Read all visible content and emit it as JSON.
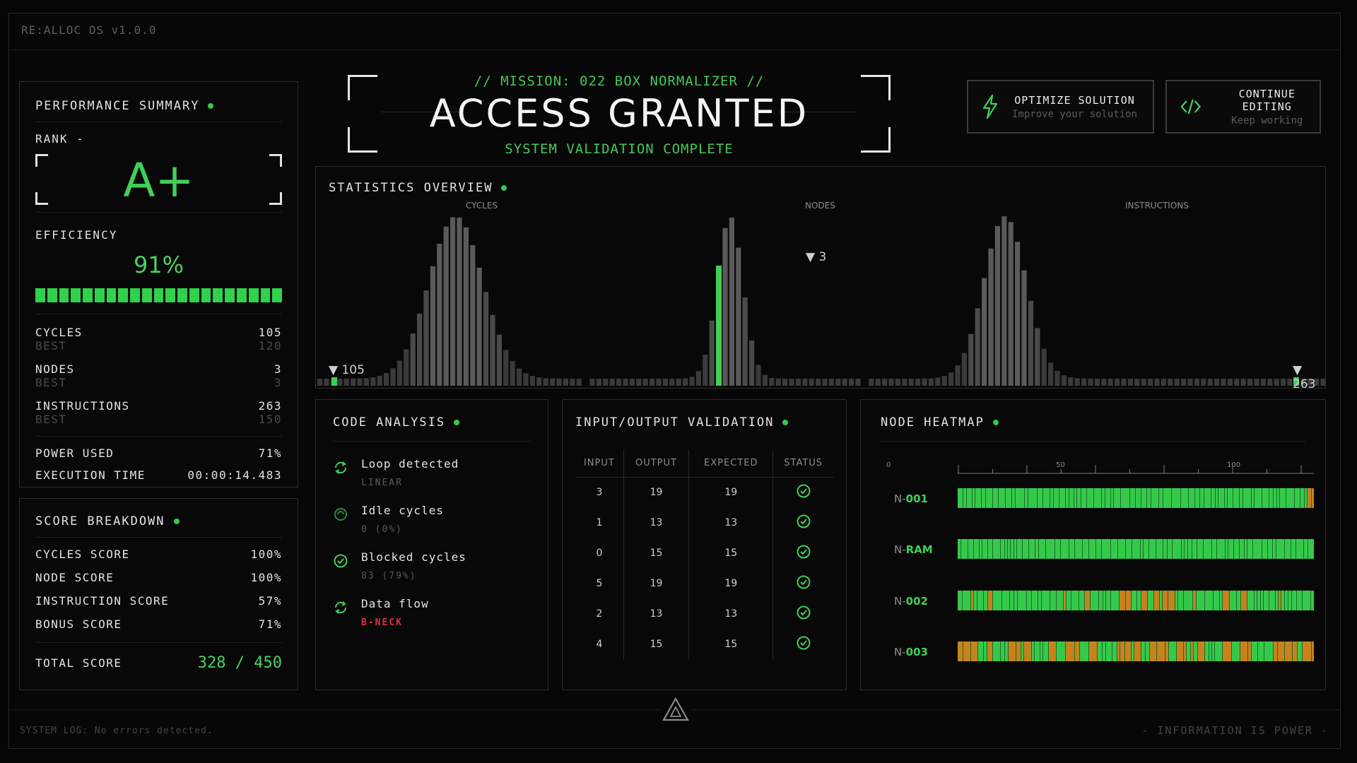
{
  "os_title": "RE:ALLOC OS v1.0.0",
  "header": {
    "mission": "// MISSION: 022 BOX NORMALIZER //",
    "title": "ACCESS GRANTED",
    "subtitle": "SYSTEM VALIDATION COMPLETE"
  },
  "buttons": {
    "optimize": {
      "label": "OPTIMIZE SOLUTION",
      "sub": "Improve your solution",
      "icon": "lightning-icon"
    },
    "continue": {
      "label": "CONTINUE EDITING",
      "sub": "Keep working",
      "icon": "code-icon"
    }
  },
  "performance": {
    "title": "PERFORMANCE SUMMARY",
    "rank_label": "RANK -",
    "rank": "A+",
    "efficiency_label": "EFFICIENCY",
    "efficiency": "91%",
    "efficiency_fraction": 0.91,
    "stats": [
      {
        "label": "CYCLES",
        "value": "105",
        "best_label": "BEST",
        "best": "120"
      },
      {
        "label": "NODES",
        "value": "3",
        "best_label": "BEST",
        "best": "3"
      },
      {
        "label": "INSTRUCTIONS",
        "value": "263",
        "best_label": "BEST",
        "best": "150"
      }
    ],
    "power_label": "POWER USED",
    "power": "71%",
    "exec_label": "EXECUTION TIME",
    "exec": "00:00:14.483"
  },
  "score": {
    "title": "SCORE BREAKDOWN",
    "rows": [
      {
        "label": "CYCLES SCORE",
        "value": "100%"
      },
      {
        "label": "NODE SCORE",
        "value": "100%"
      },
      {
        "label": "INSTRUCTION SCORE",
        "value": "57%"
      },
      {
        "label": "BONUS SCORE",
        "value": "71%"
      }
    ],
    "total_label": "TOTAL SCORE",
    "total": "328 / 450"
  },
  "statistics": {
    "title": "STATISTICS OVERVIEW",
    "labels": [
      "CYCLES",
      "NODES",
      "INSTRUCTIONS"
    ],
    "markers": [
      "▼ 105",
      "▼ 3",
      "▼ 263"
    ]
  },
  "code_analysis": {
    "title": "CODE ANALYSIS",
    "items": [
      {
        "label": "Loop detected",
        "sub": "LINEAR",
        "icon": "loop-icon"
      },
      {
        "label": "Idle cycles",
        "sub": "0 (0%)",
        "icon": "idle-icon"
      },
      {
        "label": "Blocked cycles",
        "sub": "83 (79%)",
        "icon": "check-circle-icon"
      },
      {
        "label": "Data flow",
        "sub": "B-NECK",
        "icon": "refresh-icon",
        "alert": true
      }
    ]
  },
  "io": {
    "title": "INPUT/OUTPUT VALIDATION",
    "headers": [
      "INPUT",
      "OUTPUT",
      "EXPECTED",
      "STATUS"
    ],
    "rows": [
      [
        "3",
        "19",
        "19"
      ],
      [
        "1",
        "13",
        "13"
      ],
      [
        "0",
        "15",
        "15"
      ],
      [
        "5",
        "19",
        "19"
      ],
      [
        "2",
        "13",
        "13"
      ],
      [
        "4",
        "15",
        "15"
      ]
    ]
  },
  "heatmap": {
    "title": "NODE HEATMAP",
    "axis": [
      "0",
      "50",
      "100"
    ],
    "nodes": [
      {
        "prefix": "N-",
        "id": "001"
      },
      {
        "prefix": "N-",
        "id": "RAM"
      },
      {
        "prefix": "N-",
        "id": "002"
      },
      {
        "prefix": "N-",
        "id": "003"
      }
    ]
  },
  "footer": {
    "log": "SYSTEM LOG: No errors detected.",
    "tagline": "- INFORMATION IS POWER -"
  },
  "colors": {
    "accent": "#3fd057",
    "warn": "#c7821c",
    "alert": "#e0303a"
  }
}
